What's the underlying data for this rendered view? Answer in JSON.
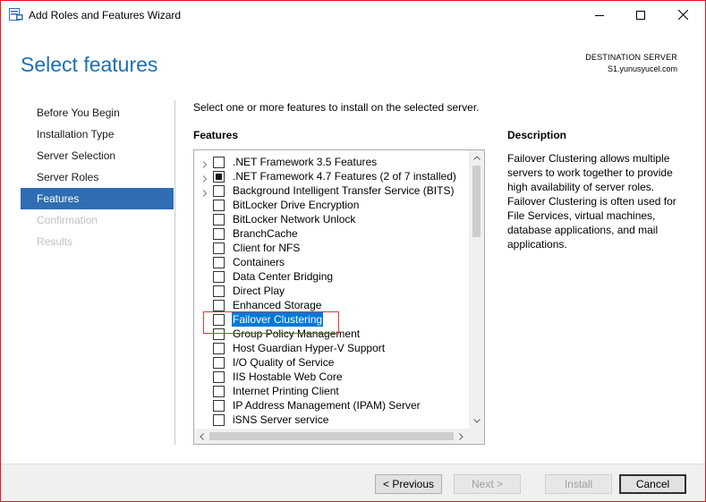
{
  "window": {
    "title": "Add Roles and Features Wizard",
    "accent_color": "#2f6eb3",
    "border_color": "#e81123"
  },
  "title_bar_icons": [
    "server-manager-icon",
    "minimize-icon",
    "maximize-icon",
    "close-icon"
  ],
  "header": {
    "page_title": "Select features",
    "destination_label": "DESTINATION SERVER",
    "destination_value": "S1.yunusyucel.com"
  },
  "nav": {
    "items": [
      {
        "label": "Before You Begin",
        "state": "normal"
      },
      {
        "label": "Installation Type",
        "state": "normal"
      },
      {
        "label": "Server Selection",
        "state": "normal"
      },
      {
        "label": "Server Roles",
        "state": "normal"
      },
      {
        "label": "Features",
        "state": "active"
      },
      {
        "label": "Confirmation",
        "state": "disabled"
      },
      {
        "label": "Results",
        "state": "disabled"
      }
    ]
  },
  "main": {
    "instruction": "Select one or more features to install on the selected server.",
    "features_heading": "Features",
    "features": [
      {
        "label": ".NET Framework 3.5 Features",
        "expandable": true,
        "checked": "none",
        "selected": false
      },
      {
        "label": ".NET Framework 4.7 Features (2 of 7 installed)",
        "expandable": true,
        "checked": "partial",
        "selected": false
      },
      {
        "label": "Background Intelligent Transfer Service (BITS)",
        "expandable": true,
        "checked": "none",
        "selected": false
      },
      {
        "label": "BitLocker Drive Encryption",
        "expandable": false,
        "checked": "none",
        "selected": false
      },
      {
        "label": "BitLocker Network Unlock",
        "expandable": false,
        "checked": "none",
        "selected": false
      },
      {
        "label": "BranchCache",
        "expandable": false,
        "checked": "none",
        "selected": false
      },
      {
        "label": "Client for NFS",
        "expandable": false,
        "checked": "none",
        "selected": false
      },
      {
        "label": "Containers",
        "expandable": false,
        "checked": "none",
        "selected": false
      },
      {
        "label": "Data Center Bridging",
        "expandable": false,
        "checked": "none",
        "selected": false
      },
      {
        "label": "Direct Play",
        "expandable": false,
        "checked": "none",
        "selected": false
      },
      {
        "label": "Enhanced Storage",
        "expandable": false,
        "checked": "none",
        "selected": false
      },
      {
        "label": "Failover Clustering",
        "expandable": false,
        "checked": "none",
        "selected": true
      },
      {
        "label": "Group Policy Management",
        "expandable": false,
        "checked": "none",
        "selected": false
      },
      {
        "label": "Host Guardian Hyper-V Support",
        "expandable": false,
        "checked": "none",
        "selected": false
      },
      {
        "label": "I/O Quality of Service",
        "expandable": false,
        "checked": "none",
        "selected": false
      },
      {
        "label": "IIS Hostable Web Core",
        "expandable": false,
        "checked": "none",
        "selected": false
      },
      {
        "label": "Internet Printing Client",
        "expandable": false,
        "checked": "none",
        "selected": false
      },
      {
        "label": "IP Address Management (IPAM) Server",
        "expandable": false,
        "checked": "none",
        "selected": false
      },
      {
        "label": "iSNS Server service",
        "expandable": false,
        "checked": "none",
        "selected": false
      }
    ],
    "description_heading": "Description",
    "description_text": "Failover Clustering allows multiple servers to work together to provide high availability of server roles. Failover Clustering is often used for File Services, virtual machines, database applications, and mail applications."
  },
  "footer": {
    "previous_label": "< Previous",
    "next_label": "Next >",
    "install_label": "Install",
    "cancel_label": "Cancel"
  }
}
